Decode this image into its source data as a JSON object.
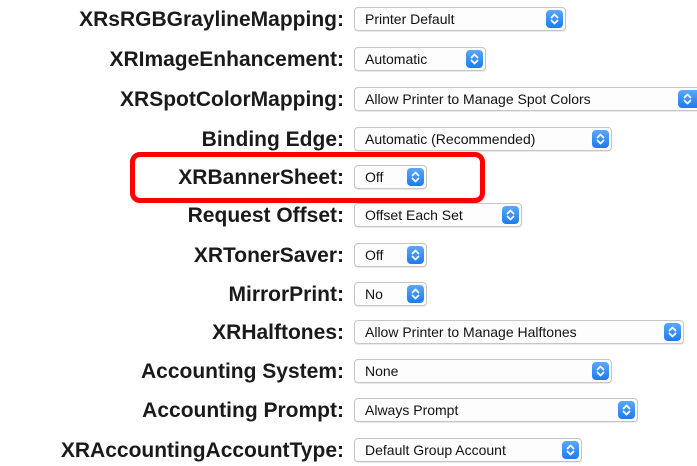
{
  "rows": [
    {
      "label": "XRsRGBGraylineMapping:",
      "value": "Printer Default"
    },
    {
      "label": "XRImageEnhancement:",
      "value": "Automatic"
    },
    {
      "label": "XRSpotColorMapping:",
      "value": "Allow Printer to Manage Spot Colors"
    },
    {
      "label": "Binding Edge:",
      "value": "Automatic (Recommended)"
    },
    {
      "label": "XRBannerSheet:",
      "value": "Off"
    },
    {
      "label": "Request Offset:",
      "value": "Offset Each Set"
    },
    {
      "label": "XRTonerSaver:",
      "value": "Off"
    },
    {
      "label": "MirrorPrint:",
      "value": "No"
    },
    {
      "label": "XRHalftones:",
      "value": "Allow Printer to Manage Halftones"
    },
    {
      "label": "Accounting System:",
      "value": "None"
    },
    {
      "label": "Accounting Prompt:",
      "value": "Always Prompt"
    },
    {
      "label": "XRAccountingAccountType:",
      "value": "Default Group Account"
    }
  ],
  "highlight_color": "#ff0000",
  "stepper_color": "#1c7bf0",
  "stepper_icon": "chevron-up-down-icon"
}
